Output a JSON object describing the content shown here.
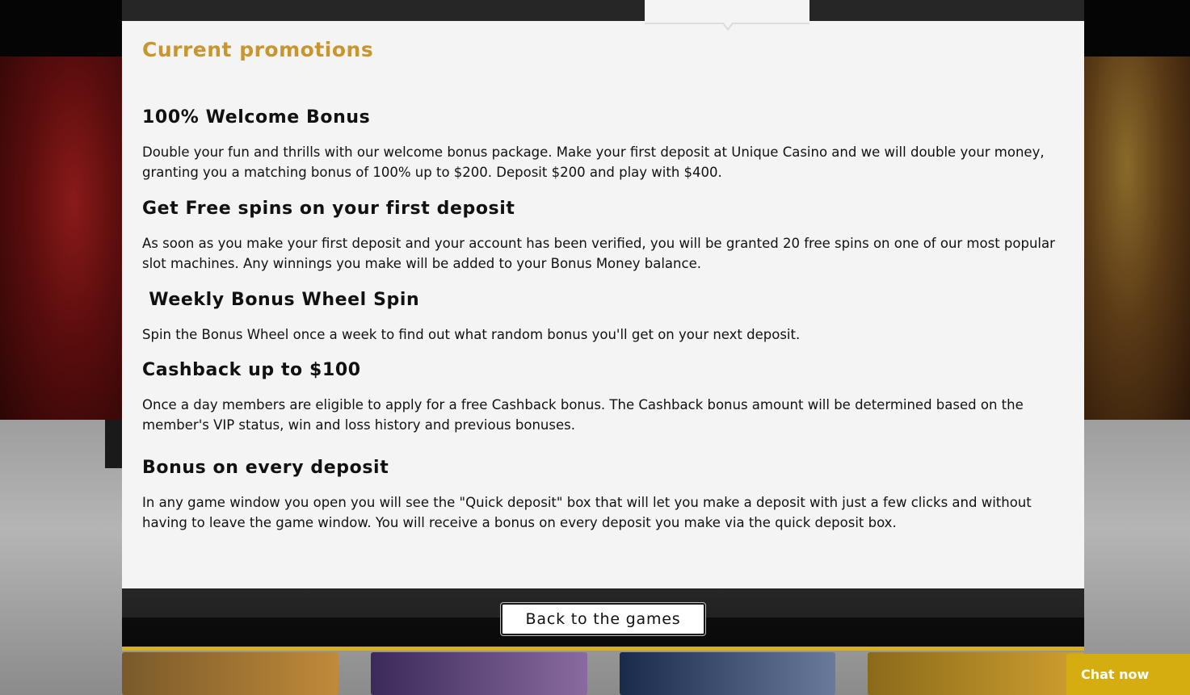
{
  "modal": {
    "title": "Current promotions",
    "title_color": "#c8952f",
    "accent_color": "#d8b21e",
    "back_button_label": "Back to the games"
  },
  "promotions": [
    {
      "heading": "100% Welcome Bonus",
      "body": "Double your fun and thrills with our welcome bonus package. Make your first deposit at Unique Casino and we will double your money, granting you a matching bonus of 100% up to $200. Deposit $200 and play with $400."
    },
    {
      "heading": "Get Free spins on your first deposit",
      "body": "As soon as you make your first deposit and your account has been verified, you will be granted 20 free spins on one of our most popular slot machines. Any winnings you make will be added to your Bonus Money balance."
    },
    {
      "heading": " Weekly Bonus Wheel Spin",
      "body": "Spin the Bonus Wheel once a week to find out what random bonus you'll get on your next deposit."
    },
    {
      "heading": "Cashback up to $100",
      "body": "Once a day members are eligible to apply for a free Cashback bonus. The Cashback bonus amount will be determined based on the member's VIP status, win and loss history and previous bonuses."
    },
    {
      "heading": "Bonus on every deposit",
      "body": "In any game window you open you will see the \"Quick deposit\" box that will let you make a deposit with just a few clicks and without having to leave the game window. You will receive a bonus on every deposit you make via the quick deposit box."
    }
  ],
  "chat": {
    "label": "Chat now",
    "color": "#d6ad10"
  }
}
